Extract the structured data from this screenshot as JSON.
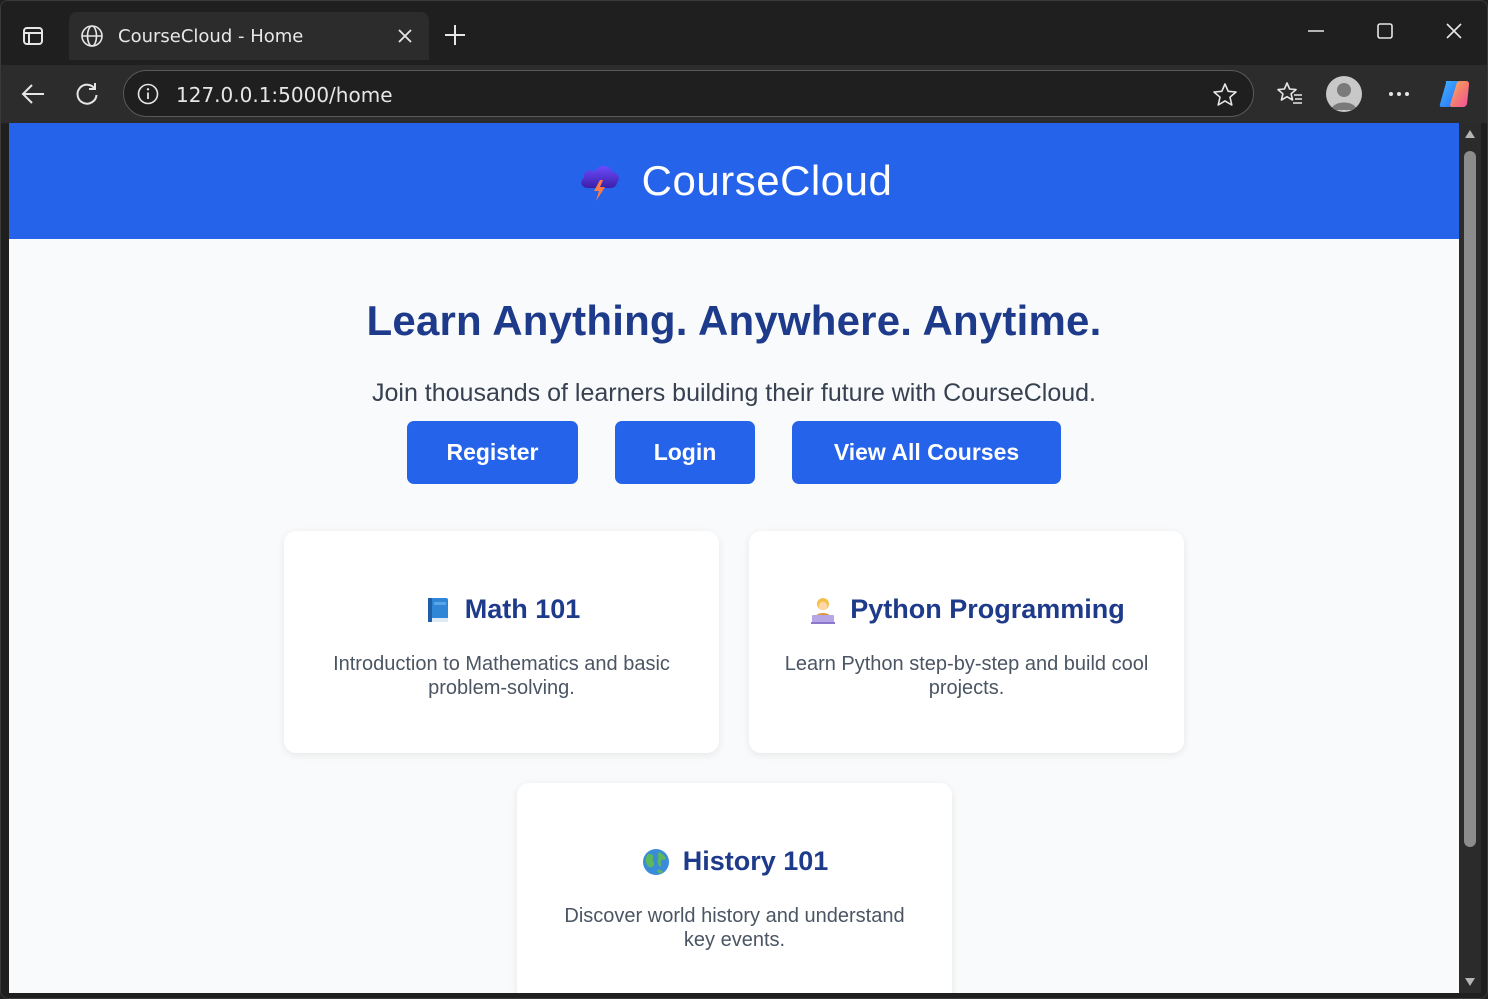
{
  "browser": {
    "tab_title": "CourseCloud - Home",
    "url": "127.0.0.1:5000/home"
  },
  "site": {
    "brand": "CourseCloud",
    "colors": {
      "header": "#2563eb",
      "heading": "#1e3a8a",
      "button": "#2563eb"
    }
  },
  "hero": {
    "headline": "Learn Anything. Anywhere. Anytime.",
    "subtitle": "Join thousands of learners building their future with CourseCloud.",
    "buttons": [
      {
        "label": "Register"
      },
      {
        "label": "Login"
      },
      {
        "label": "View All Courses"
      }
    ]
  },
  "courses": [
    {
      "icon": "blue-book-icon",
      "title": "Math 101",
      "description": "Introduction to Mathematics and basic problem-solving."
    },
    {
      "icon": "technologist-icon",
      "title": "Python Programming",
      "description": "Learn Python step-by-step and build cool projects."
    },
    {
      "icon": "globe-icon",
      "title": "History 101",
      "description": "Discover world history and understand key events."
    }
  ]
}
